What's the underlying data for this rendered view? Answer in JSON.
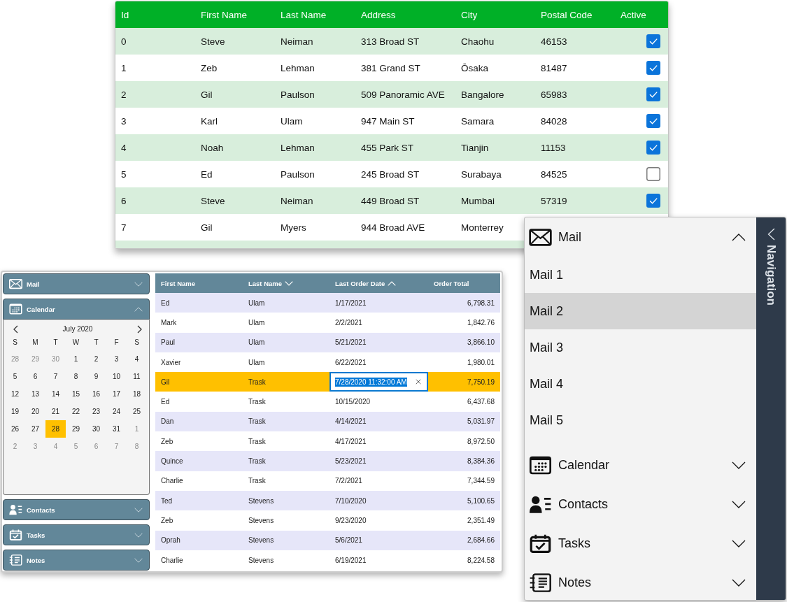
{
  "customers_grid": {
    "columns": [
      "Id",
      "First Name",
      "Last Name",
      "Address",
      "City",
      "Postal Code",
      "Active"
    ],
    "rows": [
      {
        "cells": [
          "0",
          "Steve",
          "Neiman",
          "313 Broad ST",
          "Chaohu",
          "46153"
        ],
        "active": true
      },
      {
        "cells": [
          "1",
          "Zeb",
          "Lehman",
          "381 Grand ST",
          "Ōsaka",
          "81487"
        ],
        "active": true
      },
      {
        "cells": [
          "2",
          "Gil",
          "Paulson",
          "509 Panoramic AVE",
          "Bangalore",
          "65983"
        ],
        "active": true
      },
      {
        "cells": [
          "3",
          "Karl",
          "Ulam",
          "947 Main ST",
          "Samara",
          "84028"
        ],
        "active": true
      },
      {
        "cells": [
          "4",
          "Noah",
          "Lehman",
          "455 Park ST",
          "Tianjin",
          "11153"
        ],
        "active": true
      },
      {
        "cells": [
          "5",
          "Ed",
          "Paulson",
          "245 Broad ST",
          "Surabaya",
          "84525"
        ],
        "active": false
      },
      {
        "cells": [
          "6",
          "Steve",
          "Neiman",
          "449 Broad ST",
          "Mumbai",
          "57319"
        ],
        "active": true
      },
      {
        "cells": [
          "7",
          "Gil",
          "Myers",
          "944 Broad AVE",
          "Monterrey"
        ]
      }
    ]
  },
  "orders_window": {
    "accordion": [
      {
        "kind": "mail",
        "label": "Mail",
        "expanded": false
      },
      {
        "kind": "calendar",
        "label": "Calendar",
        "expanded": true,
        "calendar": {
          "month": "July 2020",
          "weekdays": [
            "S",
            "M",
            "T",
            "W",
            "T",
            "F",
            "S"
          ],
          "weeks": [
            [
              {
                "day": "28",
                "other_month": true,
                "selected": false
              },
              {
                "day": "29",
                "other_month": true,
                "selected": false
              },
              {
                "day": "30",
                "other_month": true,
                "selected": false
              },
              {
                "day": "1",
                "other_month": false,
                "selected": false
              },
              {
                "day": "2",
                "other_month": false,
                "selected": false
              },
              {
                "day": "3",
                "other_month": false,
                "selected": false
              },
              {
                "day": "4",
                "other_month": false,
                "selected": false
              }
            ],
            [
              {
                "day": "5",
                "other_month": false,
                "selected": false
              },
              {
                "day": "6",
                "other_month": false,
                "selected": false
              },
              {
                "day": "7",
                "other_month": false,
                "selected": false
              },
              {
                "day": "8",
                "other_month": false,
                "selected": false
              },
              {
                "day": "9",
                "other_month": false,
                "selected": false
              },
              {
                "day": "10",
                "other_month": false,
                "selected": false
              },
              {
                "day": "11",
                "other_month": false,
                "selected": false
              }
            ],
            [
              {
                "day": "12",
                "other_month": false,
                "selected": false
              },
              {
                "day": "13",
                "other_month": false,
                "selected": false
              },
              {
                "day": "14",
                "other_month": false,
                "selected": false
              },
              {
                "day": "15",
                "other_month": false,
                "selected": false
              },
              {
                "day": "16",
                "other_month": false,
                "selected": false
              },
              {
                "day": "17",
                "other_month": false,
                "selected": false
              },
              {
                "day": "18",
                "other_month": false,
                "selected": false
              }
            ],
            [
              {
                "day": "19",
                "other_month": false,
                "selected": false
              },
              {
                "day": "20",
                "other_month": false,
                "selected": false
              },
              {
                "day": "21",
                "other_month": false,
                "selected": false
              },
              {
                "day": "22",
                "other_month": false,
                "selected": false
              },
              {
                "day": "23",
                "other_month": false,
                "selected": false
              },
              {
                "day": "24",
                "other_month": false,
                "selected": false
              },
              {
                "day": "25",
                "other_month": false,
                "selected": false
              }
            ],
            [
              {
                "day": "26",
                "other_month": false,
                "selected": false
              },
              {
                "day": "27",
                "other_month": false,
                "selected": false
              },
              {
                "day": "28",
                "other_month": false,
                "selected": true
              },
              {
                "day": "29",
                "other_month": false,
                "selected": false
              },
              {
                "day": "30",
                "other_month": false,
                "selected": false
              },
              {
                "day": "31",
                "other_month": false,
                "selected": false
              },
              {
                "day": "1",
                "other_month": true,
                "selected": false
              }
            ],
            [
              {
                "day": "2",
                "other_month": true,
                "selected": false
              },
              {
                "day": "3",
                "other_month": true,
                "selected": false
              },
              {
                "day": "4",
                "other_month": true,
                "selected": false
              },
              {
                "day": "5",
                "other_month": true,
                "selected": false
              },
              {
                "day": "6",
                "other_month": true,
                "selected": false
              },
              {
                "day": "7",
                "other_month": true,
                "selected": false
              },
              {
                "day": "8",
                "other_month": true,
                "selected": false
              }
            ]
          ]
        }
      },
      {
        "kind": "contacts",
        "label": "Contacts",
        "expanded": false
      },
      {
        "kind": "tasks",
        "label": "Tasks",
        "expanded": false
      },
      {
        "kind": "notes",
        "label": "Notes",
        "expanded": false
      }
    ],
    "grid": {
      "columns": [
        {
          "label": "First Name",
          "sorted": false
        },
        {
          "label": "Last Name",
          "sorted": true,
          "descending": true
        },
        {
          "label": "Last Order Date",
          "sorted": true,
          "descending": false
        },
        {
          "label": "Order Total",
          "sorted": false
        }
      ],
      "rows": [
        {
          "first_name": "Ed",
          "last_name": "Ulam",
          "last_order_date": "1/17/2021",
          "order_total": "6,798.31",
          "selected": false,
          "editing": false
        },
        {
          "first_name": "Mark",
          "last_name": "Ulam",
          "last_order_date": "2/2/2021",
          "order_total": "1,842.76",
          "selected": false,
          "editing": false
        },
        {
          "first_name": "Paul",
          "last_name": "Ulam",
          "last_order_date": "5/21/2021",
          "order_total": "3,866.10",
          "selected": false,
          "editing": false
        },
        {
          "first_name": "Xavier",
          "last_name": "Ulam",
          "last_order_date": "6/22/2021",
          "order_total": "1,980.01",
          "selected": false,
          "editing": false
        },
        {
          "first_name": "Gil",
          "last_name": "Trask",
          "last_order_date": "7/28/2020 11:32:00 AM",
          "order_total": "7,750.19",
          "selected": true,
          "editing": true
        },
        {
          "first_name": "Ed",
          "last_name": "Trask",
          "last_order_date": "10/15/2020",
          "order_total": "6,437.68",
          "selected": false,
          "editing": false
        },
        {
          "first_name": "Dan",
          "last_name": "Trask",
          "last_order_date": "4/14/2021",
          "order_total": "5,031.97",
          "selected": false,
          "editing": false
        },
        {
          "first_name": "Zeb",
          "last_name": "Trask",
          "last_order_date": "4/17/2021",
          "order_total": "8,972.50",
          "selected": false,
          "editing": false
        },
        {
          "first_name": "Quince",
          "last_name": "Trask",
          "last_order_date": "5/23/2021",
          "order_total": "8,384.36",
          "selected": false,
          "editing": false
        },
        {
          "first_name": "Charlie",
          "last_name": "Trask",
          "last_order_date": "7/2/2021",
          "order_total": "7,344.59",
          "selected": false,
          "editing": false
        },
        {
          "first_name": "Ted",
          "last_name": "Stevens",
          "last_order_date": "7/10/2020",
          "order_total": "5,100.65",
          "selected": false,
          "editing": false
        },
        {
          "first_name": "Zeb",
          "last_name": "Stevens",
          "last_order_date": "9/23/2020",
          "order_total": "2,351.49",
          "selected": false,
          "editing": false
        },
        {
          "first_name": "Oprah",
          "last_name": "Stevens",
          "last_order_date": "5/6/2021",
          "order_total": "2,684.66",
          "selected": false,
          "editing": false
        },
        {
          "first_name": "Charlie",
          "last_name": "Stevens",
          "last_order_date": "6/19/2021",
          "order_total": "8,224.58",
          "selected": false,
          "editing": false
        }
      ]
    }
  },
  "navigation_drawer": {
    "title": "Navigation",
    "sections": [
      {
        "kind": "mail",
        "label": "Mail",
        "expanded": true,
        "items": [
          {
            "label": "Mail 1",
            "selected": false
          },
          {
            "label": "Mail 2",
            "selected": true
          },
          {
            "label": "Mail 3",
            "selected": false
          },
          {
            "label": "Mail 4",
            "selected": false
          },
          {
            "label": "Mail 5",
            "selected": false
          }
        ]
      },
      {
        "kind": "calendar",
        "label": "Calendar",
        "expanded": false
      },
      {
        "kind": "contacts",
        "label": "Contacts",
        "expanded": false
      },
      {
        "kind": "tasks",
        "label": "Tasks",
        "expanded": false
      },
      {
        "kind": "notes",
        "label": "Notes",
        "expanded": false
      }
    ]
  }
}
